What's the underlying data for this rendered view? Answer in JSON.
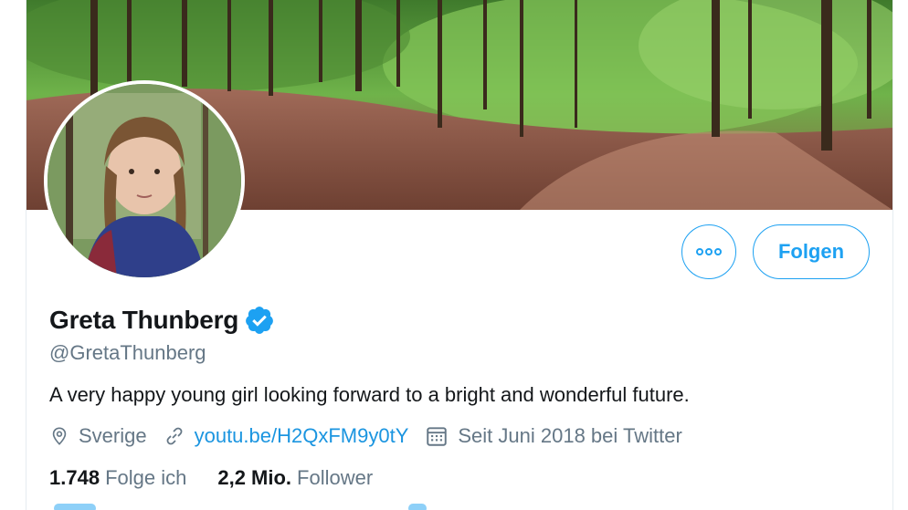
{
  "profile": {
    "name": "Greta Thunberg",
    "handle": "@GretaThunberg",
    "bio": "A very happy young girl looking forward to a bright and wonderful future.",
    "location": "Sverige",
    "link": "youtu.be/H2QxFM9y0tY",
    "joined": "Seit Juni 2018 bei Twitter",
    "following_count": "1.748",
    "following_label": "Folge ich",
    "followers_count": "2,2 Mio.",
    "followers_label": "Follower"
  },
  "actions": {
    "follow_label": "Folgen",
    "more_icon": "more-dots-icon"
  },
  "colors": {
    "accent": "#1da1f2",
    "link": "#1b95e0",
    "text": "#14171a",
    "secondary": "#657786"
  },
  "icons": {
    "verified": "verified-badge-icon",
    "location": "location-pin-icon",
    "link": "link-icon",
    "calendar": "calendar-icon"
  }
}
